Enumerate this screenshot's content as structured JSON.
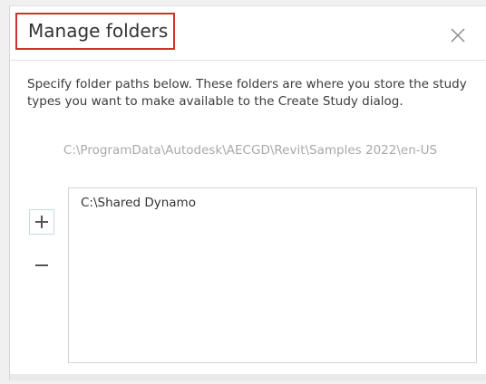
{
  "dialog": {
    "title": "Manage folders",
    "close_icon": "close-icon",
    "description": "Specify folder paths below. These folders are where you store the study types you want to make available to the Create Study dialog.",
    "default_path": "C:\\ProgramData\\Autodesk\\AECGD\\Revit\\Samples 2022\\en-US",
    "add_icon": "plus-icon",
    "remove_icon": "minus-icon",
    "folders": [
      "C:\\Shared Dynamo"
    ]
  },
  "colors": {
    "title_highlight": "#d62c2c",
    "default_path_text": "#a9a9a9",
    "add_button_border": "#c7d9ec"
  }
}
